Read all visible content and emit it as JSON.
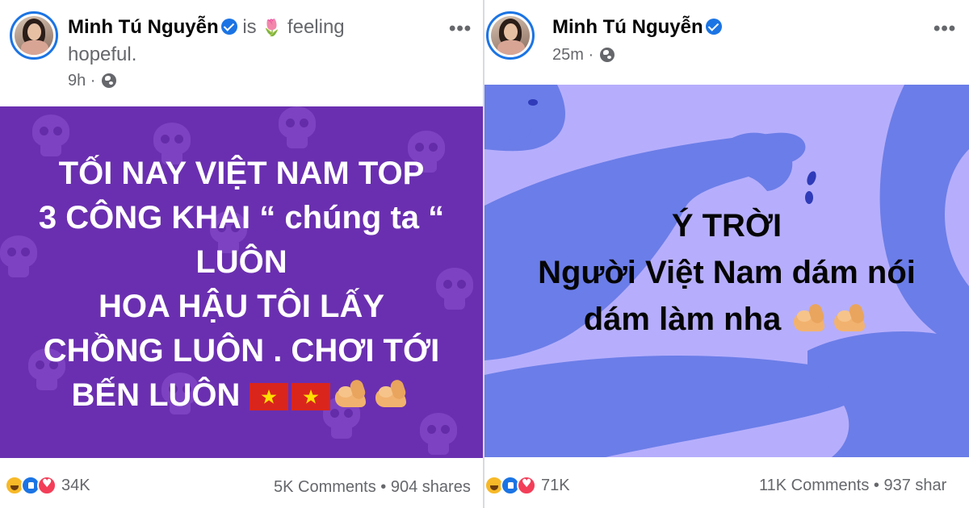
{
  "posts": [
    {
      "author": "Minh Tú Nguyễn",
      "status_prefix": "is",
      "status_emoji": "🌷",
      "status_feeling": "feeling",
      "status_word": "hopeful.",
      "time": "9h",
      "more_label": "•••",
      "background_color": "#6a2fb0",
      "text_lines": [
        "TỐI NAY VIỆT NAM TOP",
        "3 CÔNG KHAI “ chúng ta “",
        "LUÔN",
        "HOA HẬU TÔI LẤY",
        "CHỒNG LUÔN . CHƠI  TỚI",
        "BẾN LUÔN"
      ],
      "trailing_emoji": [
        "vietnam-flag",
        "vietnam-flag",
        "flexed-biceps",
        "flexed-biceps"
      ],
      "reaction_count": "34K",
      "comments": "5K Comments",
      "shares": "904 shares",
      "separator": "•"
    },
    {
      "author": "Minh Tú Nguyễn",
      "time": "25m",
      "more_label": "•••",
      "background_color": "#b6aefc",
      "text_lines": [
        "Ý TRỜI",
        "Người Việt Nam dám nói",
        "dám làm nha"
      ],
      "trailing_emoji": [
        "flexed-biceps",
        "flexed-biceps"
      ],
      "reaction_count": "71K",
      "comments": "11K Comments",
      "shares": "937 shar",
      "separator": "•"
    }
  ],
  "colors": {
    "accent": "#1b74e4",
    "meta_text": "#65676b",
    "name_text": "#050505"
  }
}
